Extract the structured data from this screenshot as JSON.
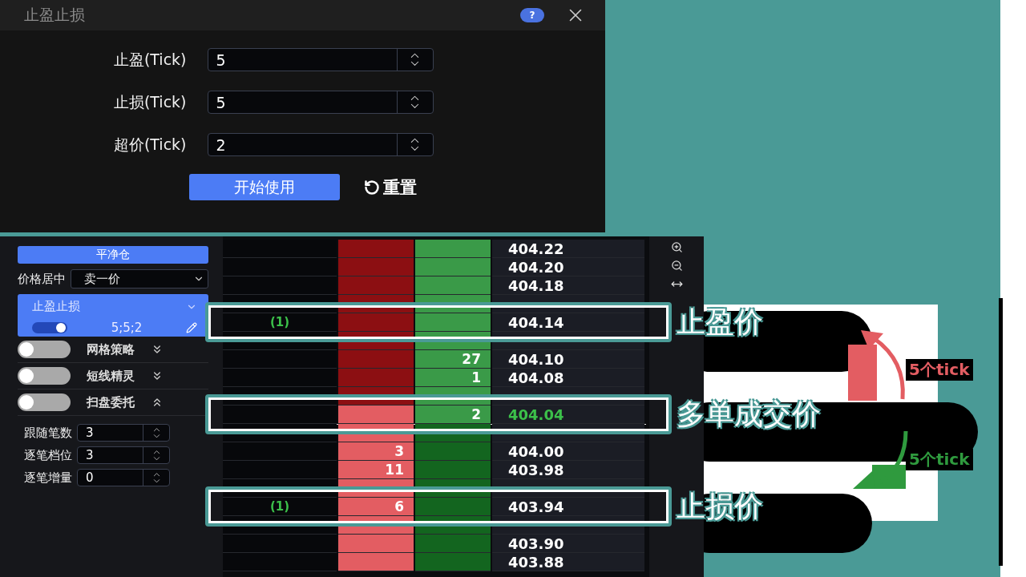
{
  "dialog": {
    "title": "止盈止损",
    "help": "?",
    "fields": [
      {
        "label": "止盈(Tick)",
        "value": "5"
      },
      {
        "label": "止损(Tick)",
        "value": "5"
      },
      {
        "label": "超价(Tick)",
        "value": "2"
      }
    ],
    "buttons": [
      {
        "kind": "primary",
        "label": "开始使用"
      },
      {
        "kind": "reset",
        "label": "重置"
      }
    ]
  },
  "sidebar": {
    "flatten_button": "平净仓",
    "price_center": {
      "label": "价格居中",
      "value": "卖一价"
    },
    "stop_card": {
      "title": "止盈止损",
      "on": true,
      "summary": "5;5;2"
    },
    "strategies": [
      {
        "label": "网格策略",
        "on": false,
        "expanded": false
      },
      {
        "label": "短线精灵",
        "on": false,
        "expanded": false
      },
      {
        "label": "扫盘委托",
        "on": false,
        "expanded": true
      }
    ],
    "fields": [
      {
        "label": "跟随笔数",
        "value": "3"
      },
      {
        "label": "逐笔档位",
        "value": "3"
      },
      {
        "label": "逐笔增量",
        "value": "0"
      }
    ]
  },
  "ladder": {
    "rows": [
      {
        "kind": "quote",
        "price": "404.22",
        "ask_dark": true,
        "bid_dark": false,
        "last": false
      },
      {
        "kind": "quote",
        "price": "404.20",
        "ask_dark": true,
        "bid_dark": false,
        "last": false
      },
      {
        "kind": "quote",
        "price": "404.18",
        "ask_dark": true,
        "bid_dark": false,
        "last": false
      },
      {
        "kind": "gap",
        "ask_dark": true,
        "bid_dark": false
      },
      {
        "kind": "quote",
        "price": "404.14",
        "order": "(1)",
        "ask_dark": true,
        "bid_dark": false,
        "last": false,
        "callout": "止盈价"
      },
      {
        "kind": "gap",
        "ask_dark": true,
        "bid_dark": false
      },
      {
        "kind": "quote",
        "price": "404.10",
        "bid": "27",
        "ask_dark": true,
        "bid_dark": false,
        "last": false
      },
      {
        "kind": "quote",
        "price": "404.08",
        "bid": "1",
        "ask_dark": true,
        "bid_dark": false,
        "last": false
      },
      {
        "kind": "gap",
        "ask_dark": true,
        "bid_dark": false
      },
      {
        "kind": "quote",
        "price": "404.04",
        "bid": "2",
        "ask_dark": false,
        "bid_dark": false,
        "last": true,
        "callout": "多单成交价"
      },
      {
        "kind": "gap",
        "ask_dark": false,
        "bid_dark": true
      },
      {
        "kind": "quote",
        "price": "404.00",
        "ask": "3",
        "ask_dark": false,
        "bid_dark": true,
        "last": false
      },
      {
        "kind": "quote",
        "price": "403.98",
        "ask": "11",
        "ask_dark": false,
        "bid_dark": true,
        "last": false
      },
      {
        "kind": "gap",
        "ask_dark": false,
        "bid_dark": true
      },
      {
        "kind": "quote",
        "price": "403.94",
        "order": "(1)",
        "ask": "6",
        "ask_dark": false,
        "bid_dark": true,
        "last": false,
        "callout": "止损价"
      },
      {
        "kind": "gap",
        "ask_dark": false,
        "bid_dark": true
      },
      {
        "kind": "quote",
        "price": "403.90",
        "ask_dark": false,
        "bid_dark": true,
        "last": false
      },
      {
        "kind": "quote",
        "price": "403.88",
        "ask_dark": false,
        "bid_dark": true,
        "last": false
      }
    ]
  },
  "arrows": [
    {
      "label": "5个tick",
      "color": "#e35d62"
    },
    {
      "label": "5个tick",
      "color": "#2f9a3e"
    }
  ]
}
